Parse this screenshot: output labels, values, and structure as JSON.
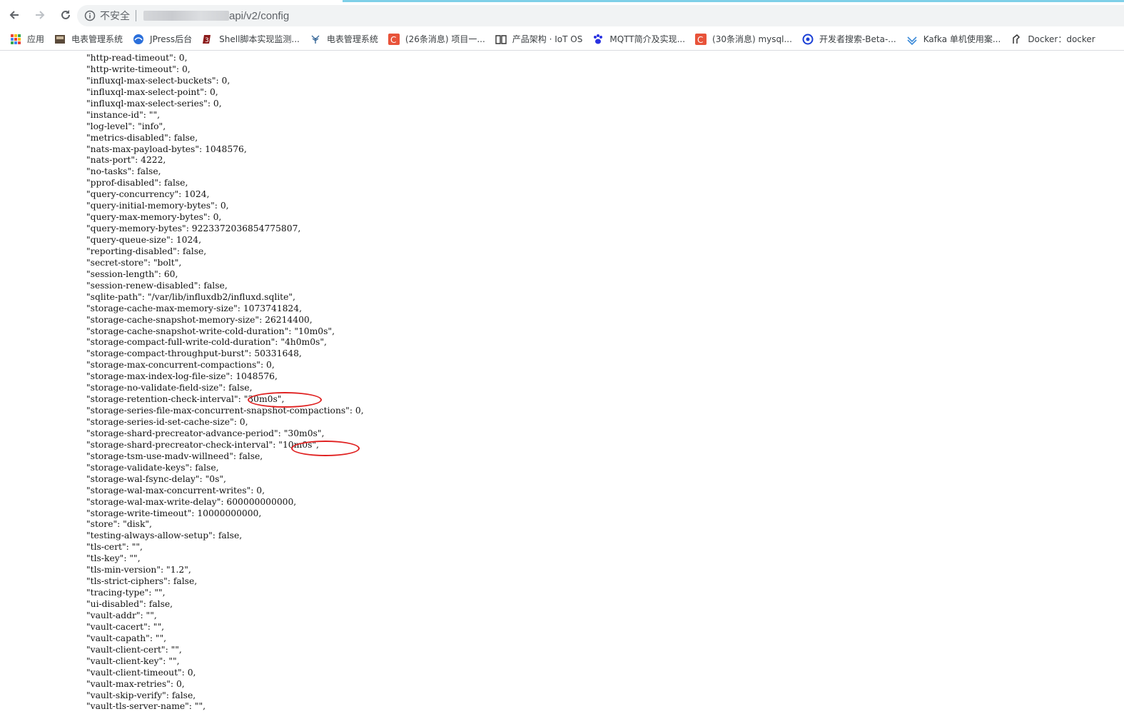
{
  "browser": {
    "insecure_label": "不安全",
    "url_path": "api/v2/config",
    "accent_color": "#7fd0e8"
  },
  "bookmarks": [
    {
      "label": "应用",
      "icon": "apps-grid-icon"
    },
    {
      "label": "电表管理系统",
      "icon": "meter-icon"
    },
    {
      "label": "JPress后台",
      "icon": "jpress-icon"
    },
    {
      "label": "Shell脚本实现监测...",
      "icon": "shell-icon"
    },
    {
      "label": "电表管理系统",
      "icon": "plant-icon"
    },
    {
      "label": "(26条消息) 项目一...",
      "icon": "csdn-icon"
    },
    {
      "label": "产品架构 · IoT OS",
      "icon": "book-icon"
    },
    {
      "label": "MQTT简介及实现...",
      "icon": "baidu-paw-icon"
    },
    {
      "label": "(30条消息) mysql...",
      "icon": "csdn-icon"
    },
    {
      "label": "开发者搜索-Beta-...",
      "icon": "dev-search-icon"
    },
    {
      "label": "Kafka 单机使用案...",
      "icon": "kafka-icon"
    },
    {
      "label": "Docker：docker",
      "icon": "docker-icon"
    }
  ],
  "config_lines": [
    "\"http-read-timeout\": 0,",
    "\"http-write-timeout\": 0,",
    "\"influxql-max-select-buckets\": 0,",
    "\"influxql-max-select-point\": 0,",
    "\"influxql-max-select-series\": 0,",
    "\"instance-id\": \"\",",
    "\"log-level\": \"info\",",
    "\"metrics-disabled\": false,",
    "\"nats-max-payload-bytes\": 1048576,",
    "\"nats-port\": 4222,",
    "\"no-tasks\": false,",
    "\"pprof-disabled\": false,",
    "\"query-concurrency\": 1024,",
    "\"query-initial-memory-bytes\": 0,",
    "\"query-max-memory-bytes\": 0,",
    "\"query-memory-bytes\": 9223372036854775807,",
    "\"query-queue-size\": 1024,",
    "\"reporting-disabled\": false,",
    "\"secret-store\": \"bolt\",",
    "\"session-length\": 60,",
    "\"session-renew-disabled\": false,",
    "\"sqlite-path\": \"/var/lib/influxdb2/influxd.sqlite\",",
    "\"storage-cache-max-memory-size\": 1073741824,",
    "\"storage-cache-snapshot-memory-size\": 26214400,",
    "\"storage-cache-snapshot-write-cold-duration\": \"10m0s\",",
    "\"storage-compact-full-write-cold-duration\": \"4h0m0s\",",
    "\"storage-compact-throughput-burst\": 50331648,",
    "\"storage-max-concurrent-compactions\": 0,",
    "\"storage-max-index-log-file-size\": 1048576,",
    "\"storage-no-validate-field-size\": false,",
    "\"storage-retention-check-interval\": \"30m0s\",",
    "\"storage-series-file-max-concurrent-snapshot-compactions\": 0,",
    "\"storage-series-id-set-cache-size\": 0,",
    "\"storage-shard-precreator-advance-period\": \"30m0s\",",
    "\"storage-shard-precreator-check-interval\": \"10m0s\",",
    "\"storage-tsm-use-madv-willneed\": false,",
    "\"storage-validate-keys\": false,",
    "\"storage-wal-fsync-delay\": \"0s\",",
    "\"storage-wal-max-concurrent-writes\": 0,",
    "\"storage-wal-max-write-delay\": 600000000000,",
    "\"storage-write-timeout\": 10000000000,",
    "\"store\": \"disk\",",
    "\"testing-always-allow-setup\": false,",
    "\"tls-cert\": \"\",",
    "\"tls-key\": \"\",",
    "\"tls-min-version\": \"1.2\",",
    "\"tls-strict-ciphers\": false,",
    "\"tracing-type\": \"\",",
    "\"ui-disabled\": false,",
    "\"vault-addr\": \"\",",
    "\"vault-cacert\": \"\",",
    "\"vault-capath\": \"\",",
    "\"vault-client-cert\": \"\",",
    "\"vault-client-key\": \"\",",
    "\"vault-client-timeout\": 0,",
    "\"vault-max-retries\": 0,",
    "\"vault-skip-verify\": false,",
    "\"vault-tls-server-name\": \"\","
  ],
  "highlight_color": "#e02020"
}
